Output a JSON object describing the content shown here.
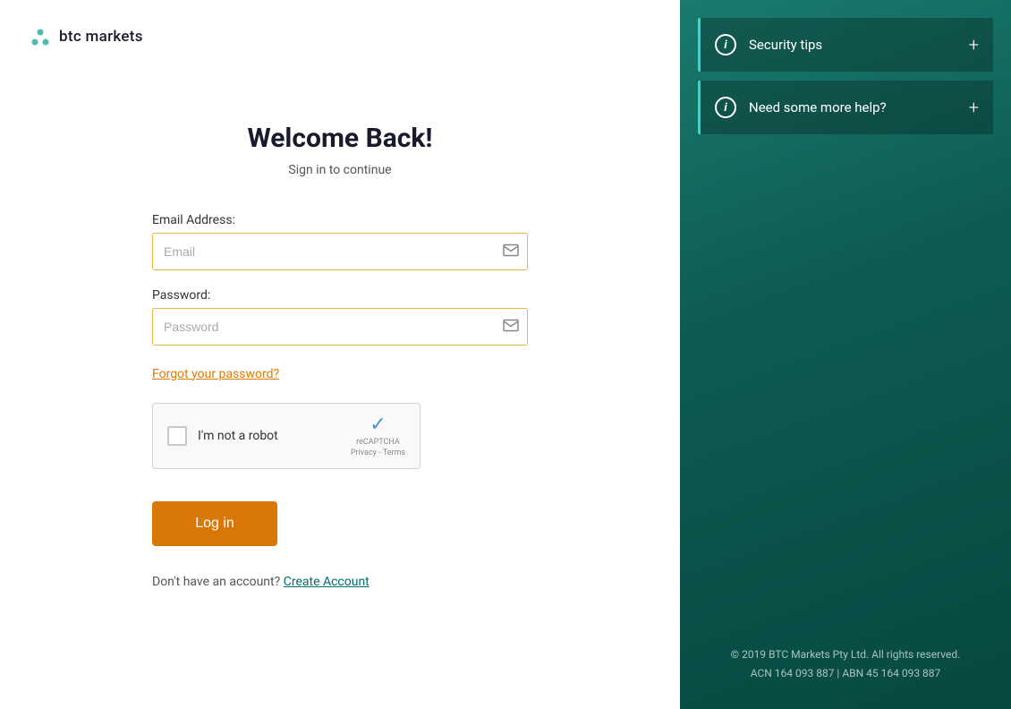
{
  "brand": {
    "logo_alt": "BTC Markets Logo",
    "logo_text": "btc markets"
  },
  "login": {
    "title": "Welcome Back!",
    "subtitle": "Sign in to continue",
    "email_label": "Email Address:",
    "email_placeholder": "Email",
    "password_label": "Password:",
    "password_placeholder": "Password",
    "forgot_password": "Forgot your password?",
    "recaptcha_label": "I'm not a robot",
    "recaptcha_brand": "reCAPTCHA",
    "recaptcha_links": "Privacy - Terms",
    "login_button": "Log in",
    "no_account_text": "Don't have an account?",
    "create_account_link": "Create Account"
  },
  "right_panel": {
    "accordion_items": [
      {
        "label": "Security tips",
        "icon": "i"
      },
      {
        "label": "Need some more help?",
        "icon": "i"
      }
    ],
    "footer": {
      "line1": "© 2019 BTC Markets Pty Ltd. All rights reserved.",
      "line2": "ACN 164 093 887 | ABN 45 164 093 887"
    }
  }
}
